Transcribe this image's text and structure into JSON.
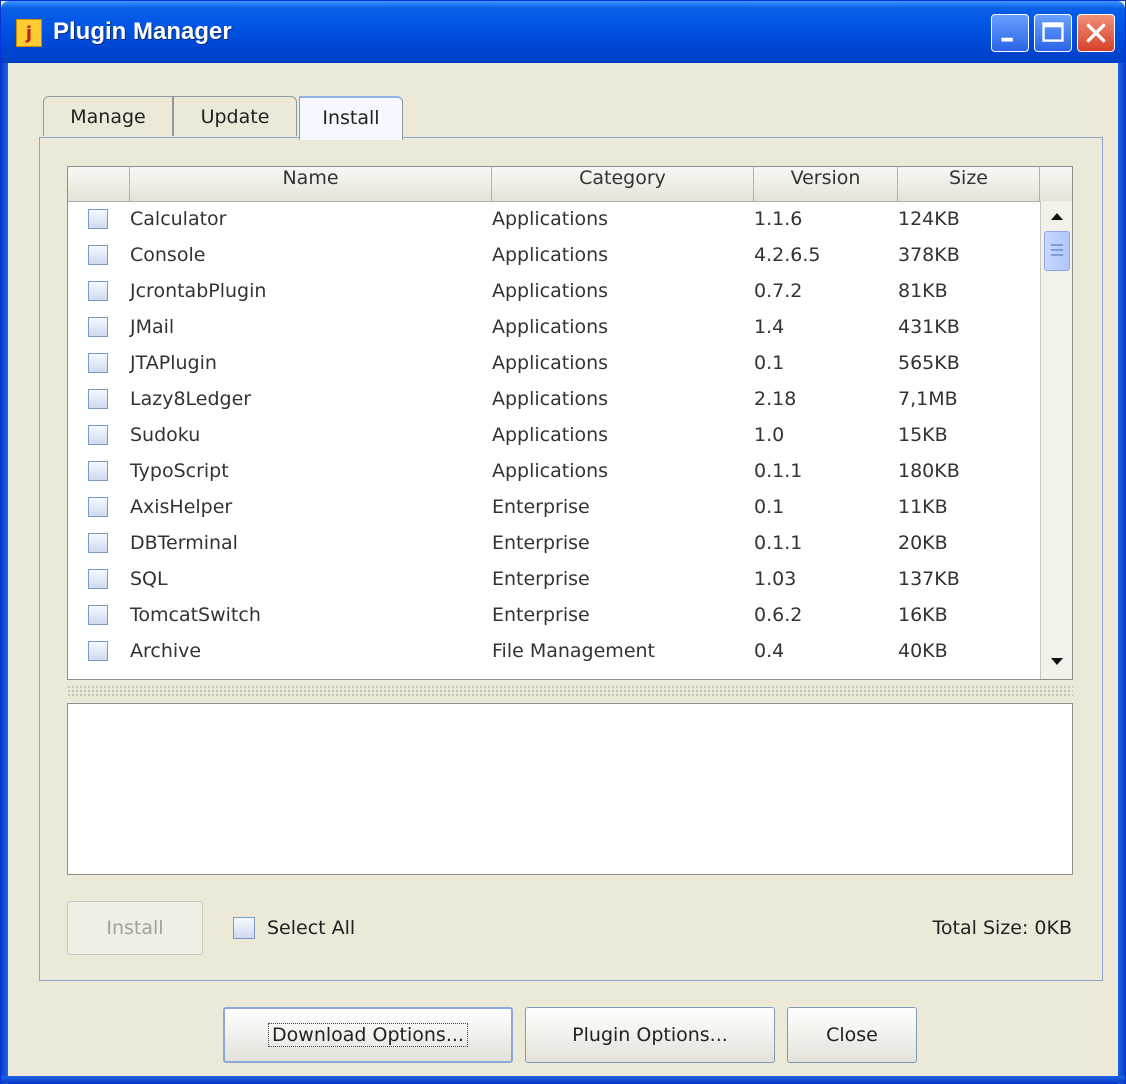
{
  "window": {
    "title": "Plugin Manager",
    "icon": "jedit-icon",
    "controls": [
      "minimize-icon",
      "maximize-icon",
      "close-icon"
    ]
  },
  "tabs": [
    {
      "label": "Manage",
      "selected": false
    },
    {
      "label": "Update",
      "selected": false
    },
    {
      "label": "Install",
      "selected": true
    }
  ],
  "table": {
    "columns": [
      "",
      "Name",
      "Category",
      "Version",
      "Size"
    ],
    "rows": [
      {
        "name": "Calculator",
        "category": "Applications",
        "version": "1.1.6",
        "size": "124KB"
      },
      {
        "name": "Console",
        "category": "Applications",
        "version": "4.2.6.5",
        "size": "378KB"
      },
      {
        "name": "JcrontabPlugin",
        "category": "Applications",
        "version": "0.7.2",
        "size": "81KB"
      },
      {
        "name": "JMail",
        "category": "Applications",
        "version": "1.4",
        "size": "431KB"
      },
      {
        "name": "JTAPlugin",
        "category": "Applications",
        "version": "0.1",
        "size": "565KB"
      },
      {
        "name": "Lazy8Ledger",
        "category": "Applications",
        "version": "2.18",
        "size": "7,1MB"
      },
      {
        "name": "Sudoku",
        "category": "Applications",
        "version": "1.0",
        "size": "15KB"
      },
      {
        "name": "TypoScript",
        "category": "Applications",
        "version": "0.1.1",
        "size": "180KB"
      },
      {
        "name": "AxisHelper",
        "category": "Enterprise",
        "version": "0.1",
        "size": "11KB"
      },
      {
        "name": "DBTerminal",
        "category": "Enterprise",
        "version": "0.1.1",
        "size": "20KB"
      },
      {
        "name": "SQL",
        "category": "Enterprise",
        "version": "1.03",
        "size": "137KB"
      },
      {
        "name": "TomcatSwitch",
        "category": "Enterprise",
        "version": "0.6.2",
        "size": "16KB"
      },
      {
        "name": "Archive",
        "category": "File Management",
        "version": "0.4",
        "size": "40KB"
      }
    ]
  },
  "footer": {
    "install_label": "Install",
    "select_all_label": "Select All",
    "total_size": "Total Size: 0KB"
  },
  "buttons": {
    "download_options": "Download Options...",
    "plugin_options": "Plugin Options...",
    "close": "Close"
  },
  "colors": {
    "titlebar": "#0055e5",
    "window_bg": "#ece9d8",
    "close_button": "#d6402a"
  }
}
